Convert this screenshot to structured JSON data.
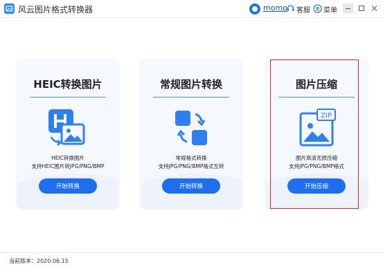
{
  "window": {
    "title": "风云图片格式转换器"
  },
  "header": {
    "user_name": "momo",
    "service_label": "客服",
    "menu_label": "菜单"
  },
  "cards": [
    {
      "title": "HEIC转换图片",
      "icon": "heic-file-icon",
      "desc_line1": "HEIC转换图片",
      "desc_line2": "支持HEIC图片转JPG/PNG/BMP",
      "button": "开始转换"
    },
    {
      "title": "常规图片转换",
      "icon": "convert-arrows-icon",
      "desc_line1": "常规格式转换",
      "desc_line2": "支持JPG/PNG/BMP格式互转",
      "button": "开始转换"
    },
    {
      "title": "图片压缩",
      "icon": "zip-image-icon",
      "desc_line1": "图片高清无损压缩",
      "desc_line2": "支持JPG/PNG/BMP格式",
      "button": "开始压缩"
    }
  ],
  "status": {
    "version_text": "当前版本：2020.06.15"
  },
  "colors": {
    "accent": "#1d6ff0",
    "highlight_border": "#e02424",
    "card_background": "#f5f8fd"
  }
}
